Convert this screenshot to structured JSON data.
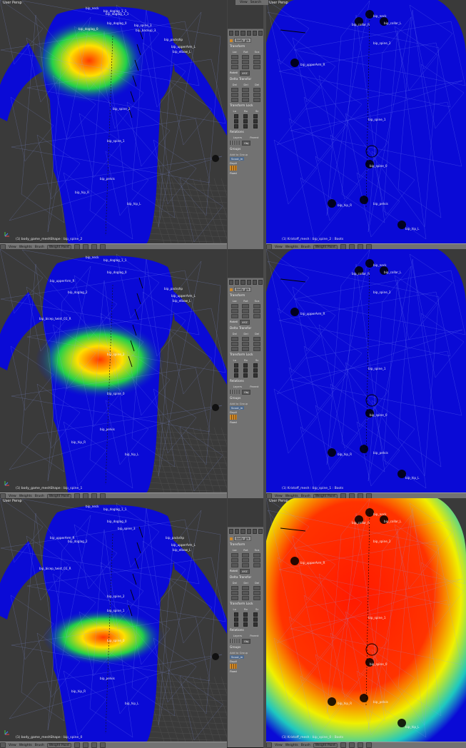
{
  "left_views": [
    {
      "title": "User Persp",
      "status": "(1) body_game_meshShape : bip_spine_2",
      "bones": [
        "bip_neck",
        "bip_doglag_1_1",
        "bip_doglag_0",
        "bip_doglag_1_1",
        "bip_doglag_0",
        "bip_spine_3",
        "bip_backup_3",
        "bip_packshp",
        "bip_upperArm_L",
        "bip_elbow_L",
        "bip_spine_2",
        "bip_spine_1",
        "bip_pelvis",
        "bip_hip_R",
        "bip_hip_L"
      ],
      "heat": "upper"
    },
    {
      "title": "",
      "status": "(1) body_game_meshShape : bip_spine_1",
      "bones": [
        "bip_neck",
        "bip_doglag_1_1",
        "bip_doglag_0",
        "bip_doglag_2",
        "bip_upperArm_R",
        "bip_packshp",
        "bip_upperArm_L",
        "bip_elbow_L",
        "bip_bicep_twist_01_R",
        "bip_spine_2",
        "bip_spine_0",
        "bip_pelvis",
        "bip_hip_R",
        "bip_hip_L"
      ],
      "heat": "middle"
    },
    {
      "title": "User Persp",
      "status": "(1) body_game_meshShape : bip_spine_0",
      "bones": [
        "bip_neck",
        "bip_doglag_1_1",
        "bip_doglag_0",
        "bip_doglag_2",
        "bip_spine_3",
        "bip_upperArm_R",
        "bip_packshp",
        "bip_upperArm_L",
        "bip_elbow_L",
        "bip_bicep_twist_01_R",
        "bip_spine_2",
        "bip_spine_1",
        "bip_spine_0",
        "bip_pelvis",
        "bip_hip_R",
        "bip_hip_L"
      ],
      "heat": "lower"
    }
  ],
  "right_views": [
    {
      "title": "User Persp",
      "status": "(1) Kristoff_mesh : bip_spine_2 : Boots",
      "bones": [
        "bip_neck",
        "bip_collar_R",
        "bip_collar_L",
        "bip_spine_2",
        "bip_upperArm_R",
        "bip_spine_1",
        "bip_spine_0",
        "bip_hip_R",
        "bip_pelvis",
        "bip_hip_L"
      ],
      "heat": "none"
    },
    {
      "title": "",
      "status": "(1) Kristoff_mesh : bip_spine_1 : Boots",
      "bones": [
        "bip_neck",
        "bip_collar_R",
        "bip_collar_L",
        "bip_spine_2",
        "bip_upperArm_R",
        "bip_spine_1",
        "bip_spine_0",
        "bip_hip_R",
        "bip_pelvis",
        "bip_hip_L"
      ],
      "heat": "none"
    },
    {
      "title": "User Persp",
      "status": "(1) Kristoff_mesh : bip_spine_0 : Boots",
      "bones": [
        "bip_neck",
        "bip_collar_R",
        "bip_collar_L",
        "bip_spine_2",
        "bip_upperArm_R",
        "bip_spine_1",
        "bip_spine_0",
        "bip_hip_R",
        "bip_pelvis",
        "bip_hip_L"
      ],
      "heat": "full"
    }
  ],
  "header": {
    "view": "View",
    "weights": "Weights",
    "brush": "Brush",
    "mode": "Weight Paint"
  },
  "right_header": {
    "view": "View",
    "weights": "Weights",
    "brush": "Brush",
    "mode": "Weight Paint"
  },
  "top_right_menu": {
    "view": "View",
    "search": "Search"
  },
  "panel": {
    "object_name": "body_gm",
    "transform": "Transform",
    "loc": "Loc",
    "rot": "Rot",
    "sca": "Sca",
    "rotation_label": "Rotati",
    "rotation_mode": "XYZ",
    "delta_transform": "Delta Transfor",
    "del1": "Del",
    "del2": "Del",
    "del3": "Del",
    "transform_locks": "Transform Lock",
    "lo": "Lo",
    "ro": "Ro",
    "sc": "Sc",
    "relations": "Relations",
    "layers": "Layers",
    "parent": "Parent",
    "parent_type": "Obj",
    "groups": "Groups",
    "add_to_group": "Add to Group",
    "group_name": "Scout_m",
    "dupli": "Dupli",
    "fixed": "Fixed"
  },
  "colors": {
    "mesh_blue": "#0a0ad6",
    "header_gray": "#727272",
    "panel_gray": "#727272",
    "floor": "#3a3a3a"
  }
}
